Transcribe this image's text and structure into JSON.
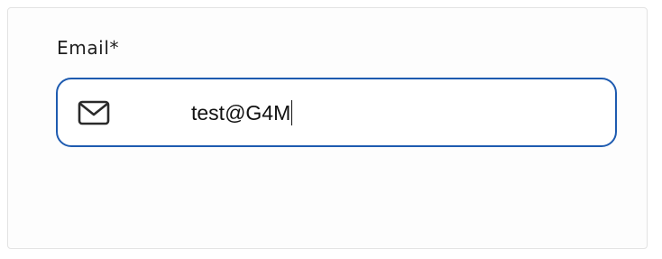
{
  "email_field": {
    "label": "Email*",
    "value": "test@G4M",
    "icon": "mail-icon",
    "border_color": "#1e5bb0"
  }
}
